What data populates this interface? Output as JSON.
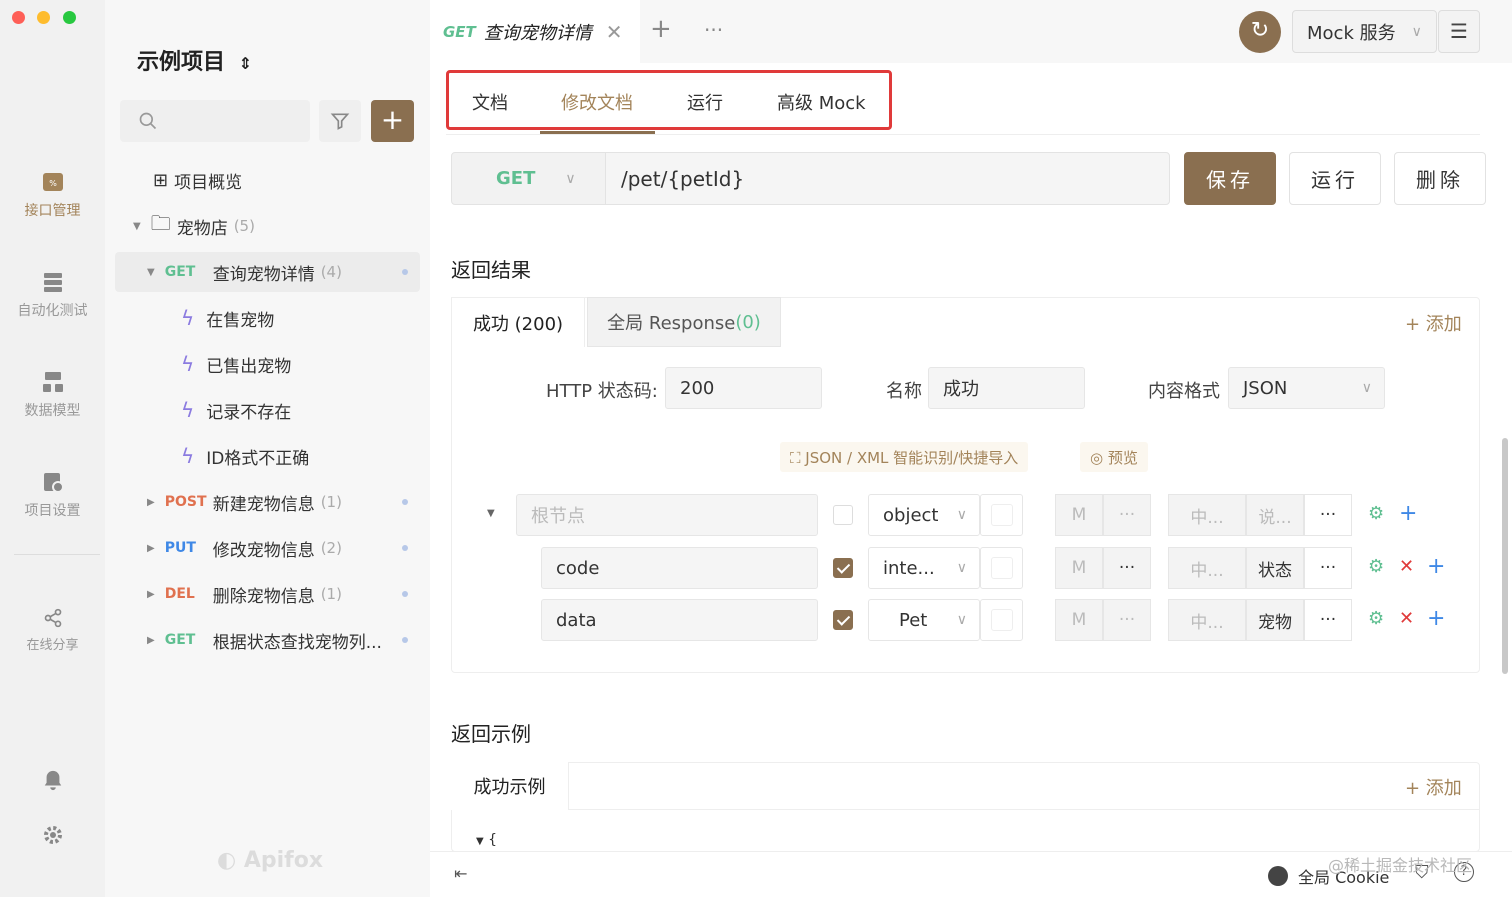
{
  "leftbar": {
    "nav": [
      {
        "label": "接口管理",
        "icon": "api-icon"
      },
      {
        "label": "自动化测试",
        "icon": "automation-icon"
      },
      {
        "label": "数据模型",
        "icon": "data-model-icon"
      },
      {
        "label": "项目设置",
        "icon": "settings-icon"
      },
      {
        "label": "在线分享",
        "icon": "share-icon"
      }
    ],
    "brand": "Apifox"
  },
  "sidebar": {
    "project_title": "示例项目",
    "overview": "项目概览",
    "folder": {
      "label": "宠物店",
      "count": "(5)"
    },
    "items": [
      {
        "method": "GET",
        "label": "查询宠物详情",
        "count": "(4)"
      },
      {
        "label": "在售宠物"
      },
      {
        "label": "已售出宠物"
      },
      {
        "label": "记录不存在"
      },
      {
        "label": "ID格式不正确"
      },
      {
        "method": "POST",
        "label": "新建宠物信息",
        "count": "(1)"
      },
      {
        "method": "PUT",
        "label": "修改宠物信息",
        "count": "(2)"
      },
      {
        "method": "DEL",
        "label": "删除宠物信息",
        "count": "(1)"
      },
      {
        "method": "GET",
        "label": "根据状态查找宠物列..."
      }
    ]
  },
  "topbar": {
    "tab_method": "GET",
    "tab_title": "查询宠物详情",
    "mock_service": "Mock 服务"
  },
  "subtabs": [
    "文档",
    "修改文档",
    "运行",
    "高级 Mock"
  ],
  "request": {
    "method": "GET",
    "url": "/pet/{petId}",
    "save": "保存",
    "run": "运行",
    "delete": "删除"
  },
  "response": {
    "section_title": "返回结果",
    "tabs": [
      {
        "label": "成功 (200)"
      },
      {
        "label": "全局 Response",
        "count": "(0)"
      }
    ],
    "add_label": "+ 添加",
    "status_label": "HTTP 状态码:",
    "status_value": "200",
    "name_label": "名称",
    "name_value": "成功",
    "format_label": "内容格式",
    "format_value": "JSON",
    "import_label": "JSON / XML 智能识别/快捷导入",
    "preview_label": "预览",
    "schema_rows": [
      {
        "name": "根节点",
        "type": "object",
        "m": "M",
        "zh": "中...",
        "desc": "说..."
      },
      {
        "name": "code",
        "type": "inte...",
        "m": "M",
        "zh": "中...",
        "desc": "状态"
      },
      {
        "name": "data",
        "type": "Pet",
        "m": "M",
        "zh": "中...",
        "desc": "宠物"
      }
    ]
  },
  "examples": {
    "section_title": "返回示例",
    "tab": "成功示例",
    "add_label": "+ 添加",
    "code_start": "{"
  },
  "footer": {
    "cookie": "全局 Cookie",
    "watermark": "@稀土掘金技术社区"
  },
  "colors": {
    "brand": "#8a6f50",
    "get": "#5fbf91",
    "post": "#e0714f",
    "put": "#3f88e6",
    "del": "#e0714f",
    "highlight_box": "#e03a3a"
  }
}
